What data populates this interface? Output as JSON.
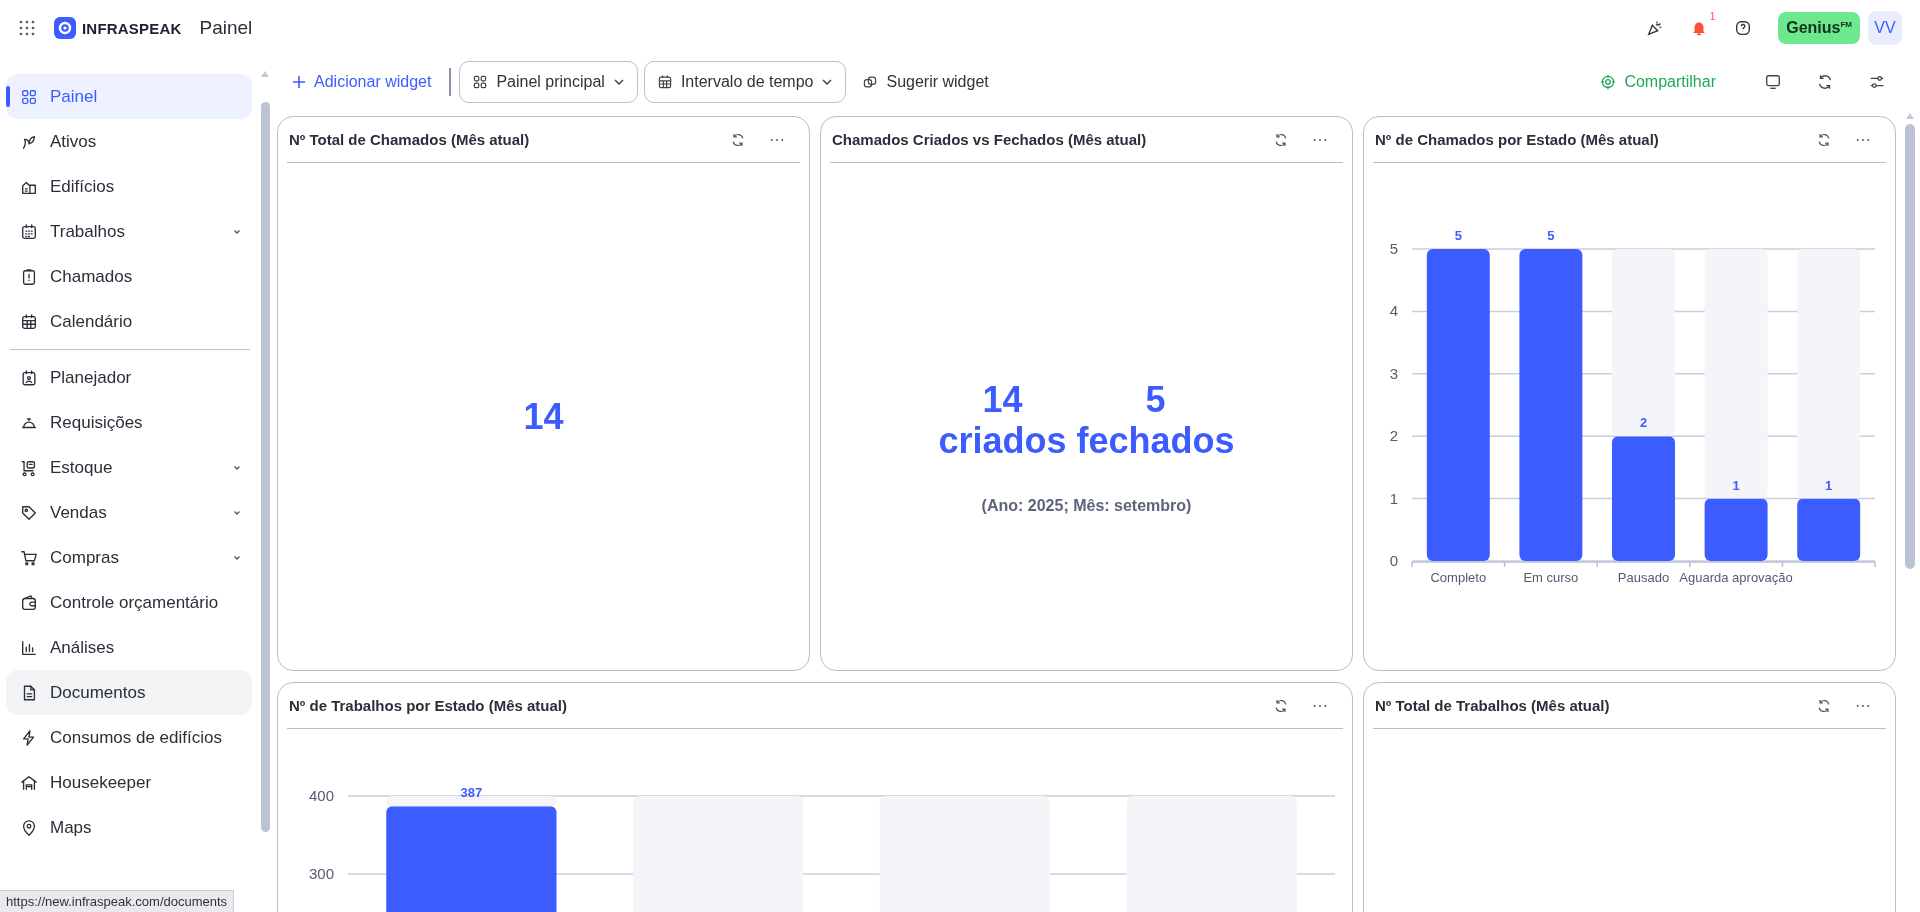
{
  "topbar": {
    "brand": "INFRASPEAK",
    "title": "Painel",
    "notifications": "1",
    "plan": {
      "label": "Genius",
      "sup": "FM"
    },
    "avatar": "VV"
  },
  "sidebar": {
    "groups": [
      [
        {
          "label": "Painel",
          "selected": true,
          "highlighted": false,
          "expandable": false
        },
        {
          "label": "Ativos",
          "selected": false,
          "highlighted": false,
          "expandable": false
        },
        {
          "label": "Edifícios",
          "selected": false,
          "highlighted": false,
          "expandable": false
        },
        {
          "label": "Trabalhos",
          "selected": false,
          "highlighted": false,
          "expandable": true
        },
        {
          "label": "Chamados",
          "selected": false,
          "highlighted": false,
          "expandable": false
        },
        {
          "label": "Calendário",
          "selected": false,
          "highlighted": false,
          "expandable": false
        }
      ],
      [
        {
          "label": "Planejador",
          "selected": false,
          "highlighted": false,
          "expandable": false
        },
        {
          "label": "Requisições",
          "selected": false,
          "highlighted": false,
          "expandable": false
        },
        {
          "label": "Estoque",
          "selected": false,
          "highlighted": false,
          "expandable": true
        },
        {
          "label": "Vendas",
          "selected": false,
          "highlighted": false,
          "expandable": true
        },
        {
          "label": "Compras",
          "selected": false,
          "highlighted": false,
          "expandable": true
        },
        {
          "label": "Controle orçamentário",
          "selected": false,
          "highlighted": false,
          "expandable": false
        },
        {
          "label": "Análises",
          "selected": false,
          "highlighted": false,
          "expandable": false
        },
        {
          "label": "Documentos",
          "selected": false,
          "highlighted": true,
          "expandable": false
        },
        {
          "label": "Consumos de edifícios",
          "selected": false,
          "highlighted": false,
          "expandable": false
        },
        {
          "label": "Housekeeper",
          "selected": false,
          "highlighted": false,
          "expandable": false
        },
        {
          "label": "Maps",
          "selected": false,
          "highlighted": false,
          "expandable": false
        }
      ]
    ]
  },
  "toolbar": {
    "add": "Adicionar widget",
    "dropdowns": [
      "Painel principal",
      "Intervalo de tempo"
    ],
    "suggest": "Sugerir widget",
    "share": "Compartilhar"
  },
  "widget_rows": [
    [
      {
        "kind": "number",
        "title": "Nº Total de Chamados (Mês atual)",
        "value": "14"
      },
      {
        "kind": "comparison",
        "title": "Chamados Criados vs Fechados (Mês atual)",
        "items": [
          {
            "value": "14",
            "label": "criados"
          },
          {
            "value": "5",
            "label": "fechados"
          }
        ],
        "caption": "(Ano: 2025; Mês: setembro)"
      },
      {
        "kind": "bar_chart",
        "title": "Nº de Chamados por Estado (Mês atual)",
        "chart_data": {
          "type": "bar",
          "categories": [
            "Completo",
            "Em curso",
            "Pausado",
            "Aguarda aprovação",
            null
          ],
          "series": [
            {
              "color": "#3d5cff",
              "values": [
                5,
                5,
                2,
                1,
                1
              ],
              "value_labels": [
                "5",
                "5",
                "2",
                "1",
                "1"
              ]
            },
            {
              "color": "#f4f5f8",
              "values": [
                0,
                0,
                3,
                4,
                4
              ]
            }
          ],
          "stacked": true,
          "ylim": [
            0,
            5
          ],
          "yticks": [
            0,
            1,
            2,
            3,
            4,
            5
          ],
          "grid": true
        }
      }
    ],
    [
      {
        "kind": "bar_chart",
        "title": "Nº de Trabalhos por Estado (Mês atual)",
        "chart_data": {
          "type": "bar",
          "series": [
            {
              "color": "#3d5cff",
              "values": [
                387,
                null,
                null,
                null
              ],
              "value_labels": [
                "387",
                null,
                null,
                null
              ]
            },
            {
              "color": "#f4f5f8",
              "values": [
                13,
                400,
                400,
                400
              ]
            }
          ],
          "stacked": true,
          "ylim": [
            0,
            400
          ],
          "yticks": [
            300,
            400
          ],
          "grid": true
        }
      },
      {
        "kind": "empty",
        "title": "Nº Total de Trabalhos (Mês atual)"
      }
    ]
  ],
  "status_url": "https://new.infraspeak.com/documents"
}
